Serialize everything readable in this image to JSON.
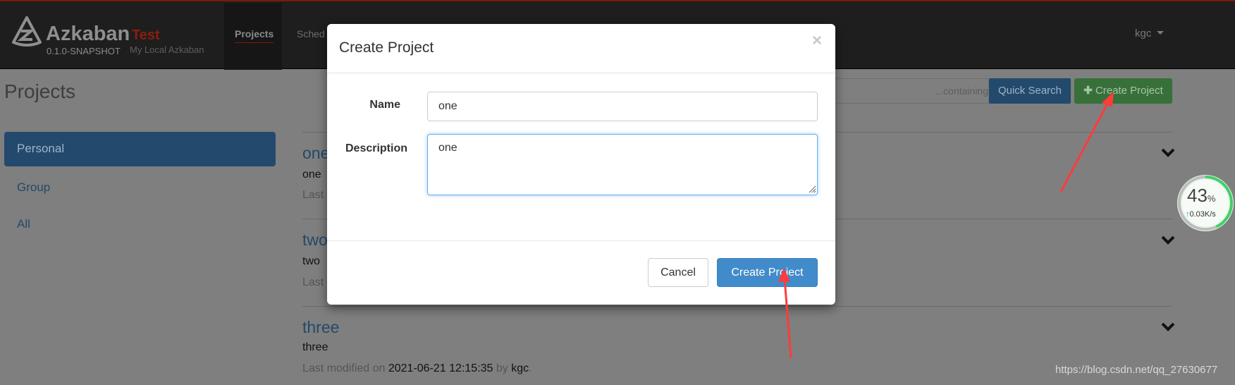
{
  "navbar": {
    "brand": "Azkaban",
    "env_tag": "Test",
    "version": "0.1.0-SNAPSHOT",
    "env_name": "My Local Azkaban",
    "items": [
      "Projects",
      "Sched"
    ],
    "user": "kgc",
    "accent": "#8b1e0b"
  },
  "page": {
    "title": "Projects",
    "search_placeholder": "containing...",
    "quick_search": "Quick Search",
    "create_project": "Create Project"
  },
  "sidebar": {
    "items": [
      {
        "label": "Personal",
        "active": true
      },
      {
        "label": "Group"
      },
      {
        "label": "All"
      }
    ]
  },
  "projects": [
    {
      "name": "one",
      "description": "one",
      "modified_prefix": "Last"
    },
    {
      "name": "two",
      "description": "two",
      "modified_prefix": "Last"
    },
    {
      "name": "three",
      "description": "three",
      "modified_prefix": "Last modified on ",
      "modified": "2021-06-21 12:15:35",
      "by": " by ",
      "user": "kgc",
      "end": "."
    }
  ],
  "modal": {
    "title": "Create Project",
    "close": "×",
    "name_label": "Name",
    "name_value": "one",
    "desc_label": "Description",
    "desc_value": "one",
    "cancel": "Cancel",
    "submit": "Create Project"
  },
  "widget": {
    "percent": "43",
    "unit": "%",
    "speed": "0.03K/s",
    "progress": 43
  },
  "watermark": "https://blog.csdn.net/qq_27630677"
}
